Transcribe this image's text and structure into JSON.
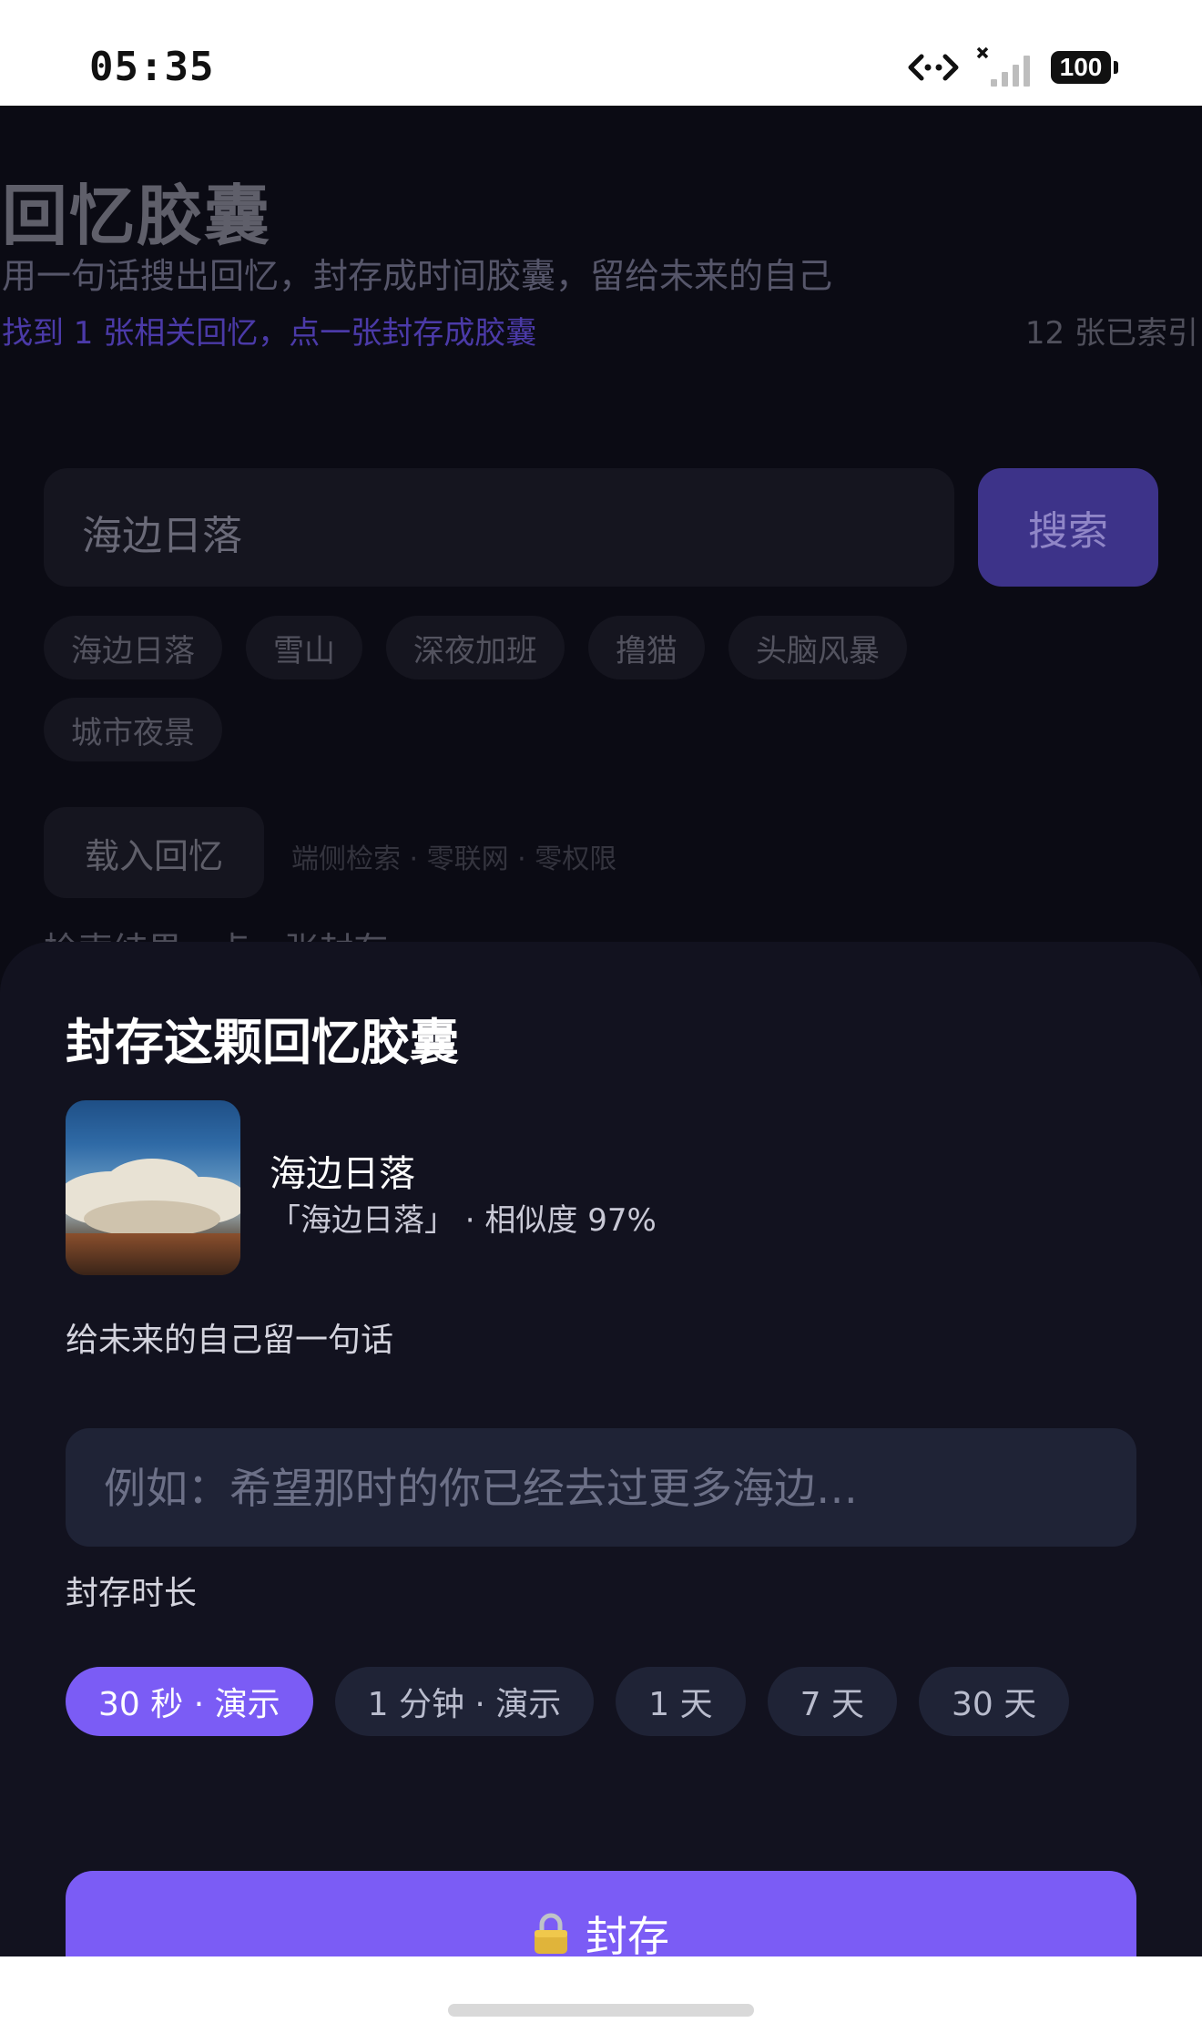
{
  "status_bar": {
    "time": "05:35",
    "battery": "100"
  },
  "background": {
    "title": "回忆胶囊",
    "subtitle": "用一句话搜出回忆，封存成时间胶囊，留给未来的自己",
    "status": "找到 1 张相关回忆，点一张封存成胶囊",
    "indexed_count": "12 张已索引",
    "search": {
      "value": "海边日落",
      "button": "搜索"
    },
    "chips": [
      "海边日落",
      "雪山",
      "深夜加班",
      "撸猫",
      "头脑风暴",
      "城市夜景"
    ],
    "load_button": "载入回忆",
    "load_hint": "端侧检索 · 零联网 · 零权限",
    "partial_text": "检索结果 · 点一张封存"
  },
  "sheet": {
    "title": "封存这颗回忆胶囊",
    "memory": {
      "title": "海边日落",
      "meta": "「海边日落」 · 相似度 97%"
    },
    "note_label": "给未来的自己留一句话",
    "note_placeholder": "例如：希望那时的你已经去过更多海边…",
    "duration_label": "封存时长",
    "durations": [
      "30 秒 · 演示",
      "1 分钟 · 演示",
      "1 天",
      "7 天",
      "30 天"
    ],
    "selected_duration": "30 秒 · 演示",
    "seal_button": "封存"
  },
  "colors": {
    "accent": "#7b5cf5",
    "sheet_bg": "#12121f",
    "app_bg": "#0b0b14"
  }
}
